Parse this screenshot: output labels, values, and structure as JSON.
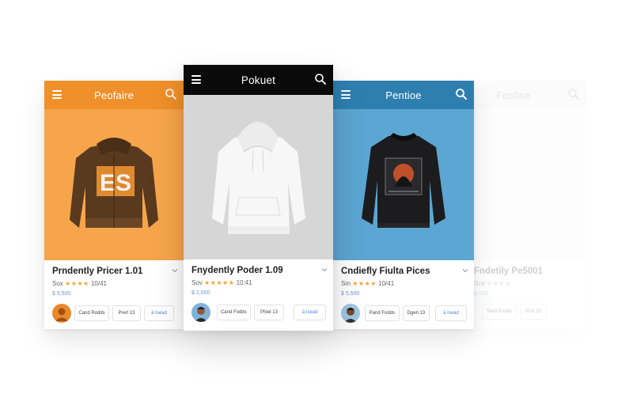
{
  "colors": {
    "orange_header": "#f0902a",
    "orange_bg": "#f7a54a",
    "black_header": "#0a0a0a",
    "grey_bg": "#d6d6d6",
    "blue_header": "#2e7fb0",
    "blue_bg": "#5ba6d3",
    "star": "#f2a431",
    "price": "#6a9ad6"
  },
  "icons": {
    "menu": "hamburger-menu-icon",
    "search": "search-icon",
    "chevron": "chevron-down-icon"
  },
  "cards": [
    {
      "header_title": "Peofaire",
      "product_name": "Prndently Pricer 1.01",
      "rating_prefix": "Sox",
      "stars": "★★★★",
      "rating_suffix": "10/41",
      "price": "$ 5,500",
      "btn1": "Cand Rodds",
      "btn2": "Prerl 13",
      "btn3": "ā Isead",
      "graphic_text": "ES"
    },
    {
      "header_title": "Pokuet",
      "product_name": "Fnydently Poder 1.09",
      "rating_prefix": "Sov",
      "stars": "★★★★★",
      "rating_suffix": "10:41",
      "price": "$ 2,000",
      "btn1": "Cand Fodds",
      "btn2": "Pfoel 13",
      "btn3": "ā Isead"
    },
    {
      "header_title": "Pentioe",
      "product_name": "Cndiefly Fiulta Pices",
      "rating_prefix": "Sm",
      "stars": "★★★★",
      "rating_suffix": "10/41",
      "price": "$ 5,500",
      "btn1": "Pand Fodds",
      "btn2": "Dgerl 13",
      "btn3": "ā Isead"
    },
    {
      "header_title": "Fosfine",
      "product_name": "Fndetily Pe5001",
      "rating_prefix": "Sce",
      "stars": "★★★★",
      "rating_suffix": "",
      "price": "$ 500",
      "btn1": "Tand Rodds",
      "btn2": "Pcol 13",
      "btn3": ""
    }
  ]
}
